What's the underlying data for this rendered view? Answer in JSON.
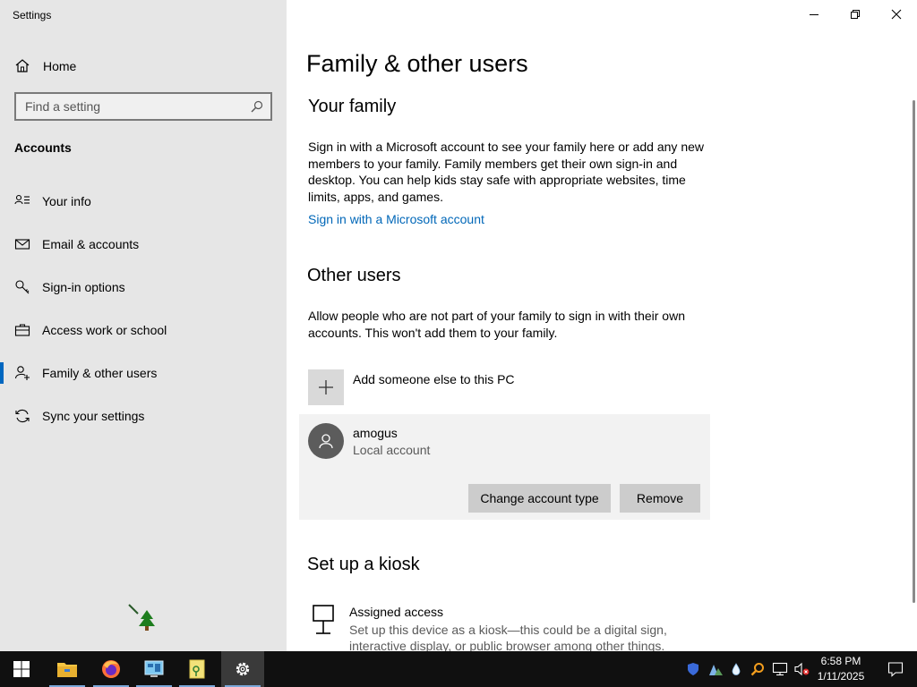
{
  "window": {
    "app_title": "Settings",
    "controls": {
      "minimize": "minimize-icon",
      "restore": "restore-icon",
      "close": "close-icon"
    }
  },
  "sidebar": {
    "home_label": "Home",
    "search_placeholder": "Find a setting",
    "section": "Accounts",
    "items": [
      {
        "label": "Your info",
        "icon": "person-card-icon",
        "active": false
      },
      {
        "label": "Email & accounts",
        "icon": "mail-icon",
        "active": false
      },
      {
        "label": "Sign-in options",
        "icon": "key-icon",
        "active": false
      },
      {
        "label": "Access work or school",
        "icon": "briefcase-icon",
        "active": false
      },
      {
        "label": "Family & other users",
        "icon": "person-add-icon",
        "active": true
      },
      {
        "label": "Sync your settings",
        "icon": "sync-icon",
        "active": false
      }
    ]
  },
  "main": {
    "page_title": "Family & other users",
    "family": {
      "heading": "Your family",
      "description": "Sign in with a Microsoft account to see your family here or add any new members to your family. Family members get their own sign-in and desktop. You can help kids stay safe with appropriate websites, time limits, apps, and games.",
      "link": "Sign in with a Microsoft account"
    },
    "other_users": {
      "heading": "Other users",
      "description": "Allow people who are not part of your family to sign in with their own accounts. This won't add them to your family.",
      "add_label": "Add someone else to this PC",
      "user": {
        "name": "amogus",
        "type": "Local account",
        "change_button": "Change account type",
        "remove_button": "Remove"
      }
    },
    "kiosk": {
      "heading": "Set up a kiosk",
      "title": "Assigned access",
      "description": "Set up this device as a kiosk—this could be a digital sign, interactive display, or public browser among other things."
    }
  },
  "taskbar": {
    "apps": [
      "start-icon",
      "file-explorer-icon",
      "firefox-icon",
      "control-panel-icon",
      "notepad-icon",
      "settings-icon"
    ],
    "tray": [
      "shield-icon",
      "network-share-icon",
      "droplet-icon",
      "search-tool-icon",
      "network-icon",
      "volume-muted-icon"
    ],
    "time": "6:58 PM",
    "date": "1/11/2025"
  },
  "colors": {
    "accent": "#0067c0",
    "link": "#0067b8",
    "sidebar_bg": "#e6e6e6",
    "taskbar_bg": "#101010"
  }
}
